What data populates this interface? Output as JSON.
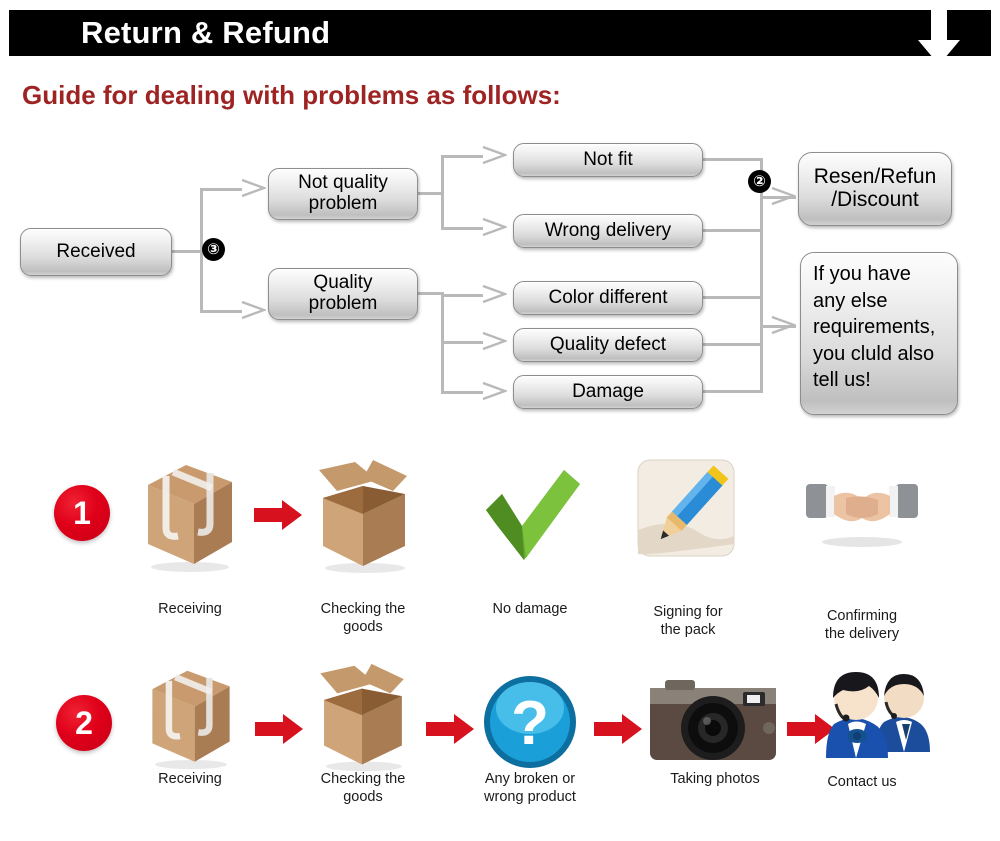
{
  "header": {
    "title": "Return & Refund",
    "arrow_icon": "down-arrow-icon",
    "subtitle": "Guide for dealing with problems as follows:",
    "bar_color": "#000000",
    "subtitle_color": "#9e2423"
  },
  "flowchart": {
    "nodes": {
      "received": "Received",
      "not_quality": "Not quality\nproblem",
      "quality": "Quality\nproblem",
      "not_fit": "Not fit",
      "wrong_delivery": "Wrong delivery",
      "color_different": "Color different",
      "quality_defect": "Quality defect",
      "damage": "Damage",
      "resolution": "Resen/Refun\n/Discount",
      "else_note": "If you have\nany else\nrequirements,\nyou cluld also\ntell us!"
    },
    "badges": {
      "step_three": "③",
      "step_two": "②"
    },
    "connector_color": "#b9b9b9",
    "node_border_color": "#8d8d8d"
  },
  "steps": {
    "row1": {
      "badge": "1",
      "items": [
        {
          "icon": "closed-box-icon",
          "caption": "Receiving"
        },
        {
          "icon": "open-box-icon",
          "caption": "Checking the\ngoods"
        },
        {
          "icon": "green-check-icon",
          "caption": "No damage"
        },
        {
          "icon": "pencil-sign-icon",
          "caption": "Signing for\nthe pack"
        },
        {
          "icon": "handshake-icon",
          "caption": "Confirming\nthe delivery"
        }
      ]
    },
    "row2": {
      "badge": "2",
      "items": [
        {
          "icon": "closed-box-icon",
          "caption": "Receiving"
        },
        {
          "icon": "open-box-icon",
          "caption": "Checking the\ngoods"
        },
        {
          "icon": "question-mark-icon",
          "caption": "Any broken or\nwrong product"
        },
        {
          "icon": "camera-icon",
          "caption": "Taking photos"
        },
        {
          "icon": "support-people-icon",
          "caption": "Contact us"
        }
      ]
    },
    "arrow_icon": "red-right-arrow-icon",
    "badge_color": "#df0019",
    "arrow_color": "#d8111f"
  }
}
